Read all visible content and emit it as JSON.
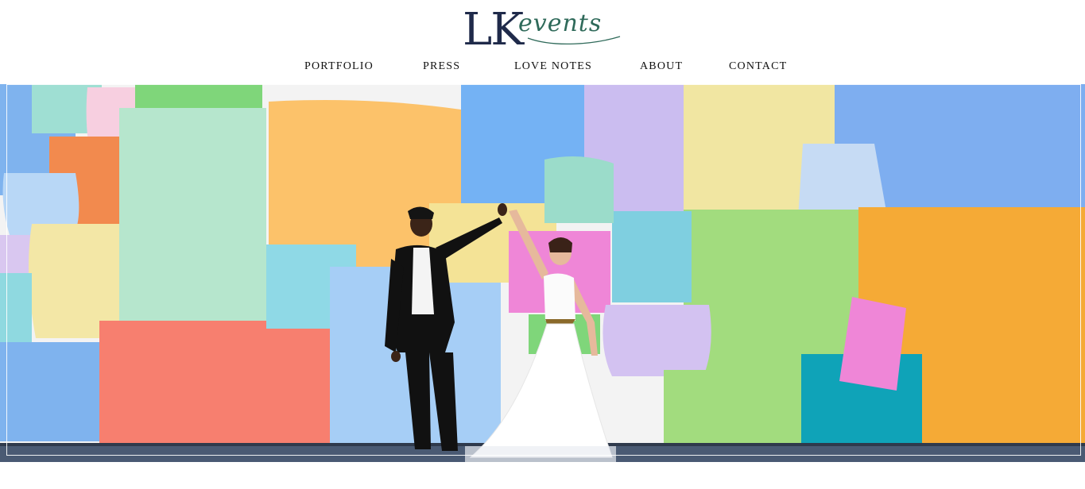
{
  "brand": {
    "logo_text_main": "LK",
    "logo_text_script": "events"
  },
  "nav": {
    "items": [
      {
        "label": "PORTFOLIO"
      },
      {
        "label": "PRESS"
      },
      {
        "label": "LOVE NOTES"
      },
      {
        "label": "ABOUT"
      },
      {
        "label": "CONTACT"
      }
    ]
  },
  "hero": {
    "image_alt": ""
  },
  "colors": {
    "navy": "#1f2a4a",
    "script_green": "#2f6a5a"
  }
}
